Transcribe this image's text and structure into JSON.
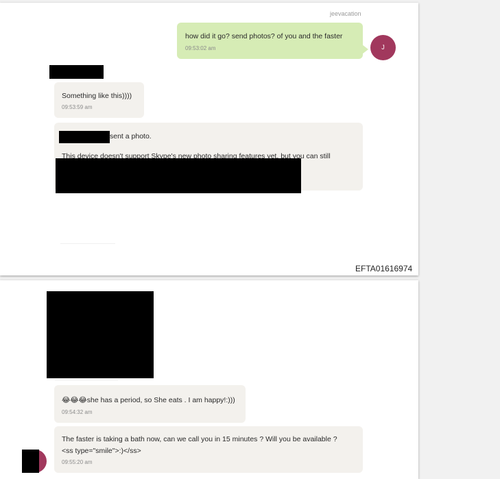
{
  "page1": {
    "sender_name": "jeevacation",
    "messages": [
      {
        "text": "how did it go?   send photos? of you and the faster",
        "time": "09:53:02 am"
      },
      {
        "text": "Something like this))))",
        "time": "09:53:59 am"
      },
      {
        "text": "sent a photo.",
        "text2": "This device doesn't support Skype's new photo sharing features yet, but you can still"
      }
    ],
    "avatar_initial": "J",
    "document_id": "EFTA01616974"
  },
  "page2": {
    "messages": [
      {
        "text": "😂😂😂she has a period, so She eats . I am happy!:)))",
        "time": "09:54:32 am"
      },
      {
        "text": "The faster is taking a bath now, can we call you in 15 minutes ? Will you be available ?",
        "text2": "<ss type=\"smile\">:)</ss>",
        "time": "09:55:20 am"
      }
    ]
  },
  "colors": {
    "outgoing_bubble": "#d6ecb5",
    "incoming_bubble": "#f3f1ed",
    "avatar": "#a1385d",
    "redaction": "#000000"
  }
}
